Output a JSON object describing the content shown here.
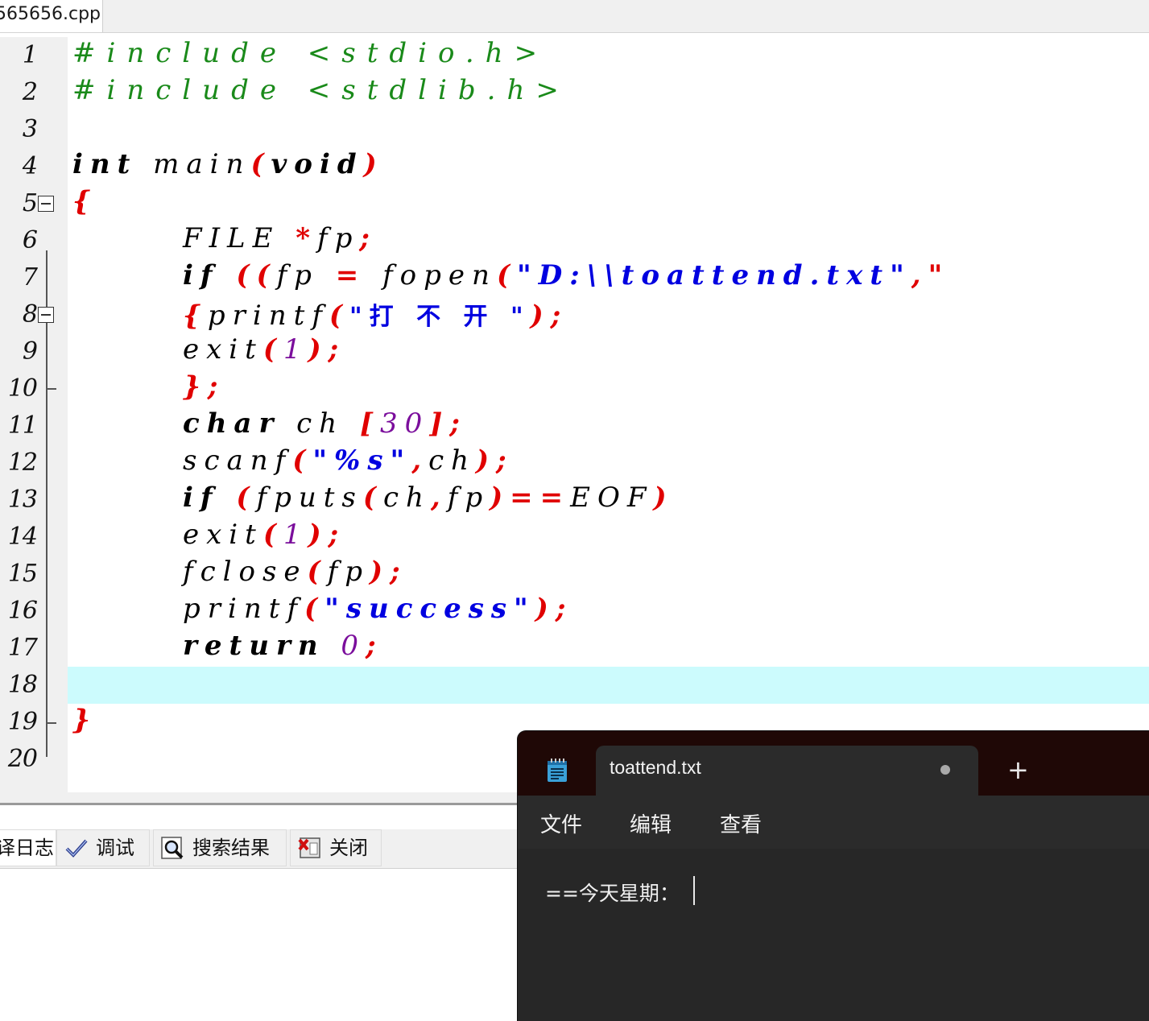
{
  "ide": {
    "file_tab": "565656.cpp",
    "line_numbers": [
      "1",
      "2",
      "3",
      "4",
      "5",
      "6",
      "7",
      "8",
      "9",
      "10",
      "11",
      "12",
      "13",
      "14",
      "15",
      "16",
      "17",
      "18",
      "19",
      "20"
    ],
    "code": {
      "l1": "#include <stdio.h>",
      "l2": "#include <stdlib.h>",
      "l4_kw": "int",
      "l4_id": " main",
      "l4_p1": "(",
      "l4_kw2": "void",
      "l4_p2": ")",
      "l5": "{",
      "l6_id": "FILE ",
      "l6_sym": "*",
      "l6_id2": "fp",
      "l6_semi": ";",
      "l7_kw": "if",
      "l7_s1": " ((",
      "l7_id": "fp",
      "l7_s2": " = ",
      "l7_id2": "fopen",
      "l7_s3": "(",
      "l7_str": "\"D:\\\\toattend.txt\"",
      "l7_s4": ",\"",
      "l8_s1": "{",
      "l8_id": "printf",
      "l8_s2": "(",
      "l8_str": "\"打 不 开 \"",
      "l8_s3": ");",
      "l9_id": "exit",
      "l9_s1": "(",
      "l9_num": "1",
      "l9_s2": ");",
      "l10": "};",
      "l11_kw": "char",
      "l11_id": " ch ",
      "l11_s1": "[",
      "l11_num": "30",
      "l11_s2": "];",
      "l12_id": "scanf",
      "l12_s1": "(",
      "l12_str": "\"%s\"",
      "l12_s2": ",",
      "l12_id2": "ch",
      "l12_s3": ");",
      "l13_kw": "if",
      "l13_s1": " (",
      "l13_id": "fputs",
      "l13_s2": "(",
      "l13_id2": "ch",
      "l13_s3": ",",
      "l13_id3": "fp",
      "l13_s4": ")==",
      "l13_id4": "EOF",
      "l13_s5": ")",
      "l14_id": "exit",
      "l14_s1": "(",
      "l14_num": "1",
      "l14_s2": ");",
      "l15_id": "fclose",
      "l15_s1": "(",
      "l15_id2": "fp",
      "l15_s2": ");",
      "l16_id": "printf",
      "l16_s1": "(",
      "l16_str": "\"success\"",
      "l16_s2": ");",
      "l17_kw": "return",
      "l17_num": " 0",
      "l17_s1": ";",
      "l19": "}"
    },
    "bottom_tabs": [
      "译日志",
      "调试",
      "搜索结果",
      "关闭"
    ]
  },
  "notepad": {
    "tab_title": "toattend.txt",
    "new_tab": "+",
    "menu": [
      "文件",
      "编辑",
      "查看"
    ],
    "content": "==今天星期："
  },
  "colors": {
    "preprocessor": "#1a8a1a",
    "symbol": "#e00000",
    "string": "#0000e0",
    "number": "#7b0e9c",
    "current_line": "#ccfbfd",
    "notepad_titlebar": "#1f0806",
    "notepad_bg": "#272727"
  }
}
